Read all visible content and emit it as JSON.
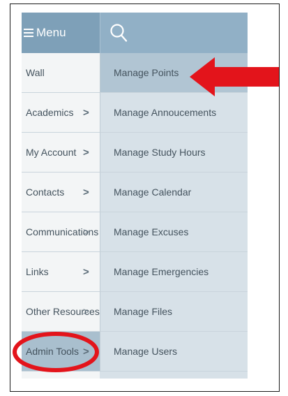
{
  "header": {
    "menu_label": "Menu",
    "menu_icon": "hamburger-icon",
    "search_icon": "search-icon",
    "bar_color": "#7ea0b8"
  },
  "left_menu": {
    "items": [
      {
        "label": "Wall",
        "chevron": ""
      },
      {
        "label": "Academics",
        "chevron": ">"
      },
      {
        "label": "My Account",
        "chevron": ">"
      },
      {
        "label": "Contacts",
        "chevron": ">"
      },
      {
        "label": "Communications",
        "chevron": ">"
      },
      {
        "label": "Links",
        "chevron": ">"
      },
      {
        "label": "Other Resources",
        "chevron": ">"
      },
      {
        "label": "Admin Tools",
        "chevron": ">"
      }
    ],
    "selected": "Admin Tools"
  },
  "submenu": {
    "items": [
      {
        "label": "Manage Points"
      },
      {
        "label": "Manage Annoucements"
      },
      {
        "label": "Manage Study Hours"
      },
      {
        "label": "Manage Calendar"
      },
      {
        "label": "Manage Excuses"
      },
      {
        "label": "Manage Emergencies"
      },
      {
        "label": "Manage Files"
      },
      {
        "label": "Manage Users"
      }
    ],
    "highlighted": "Manage Points"
  },
  "annotations": {
    "arrow_color": "#e3141b",
    "circle_color": "#e3141b"
  }
}
